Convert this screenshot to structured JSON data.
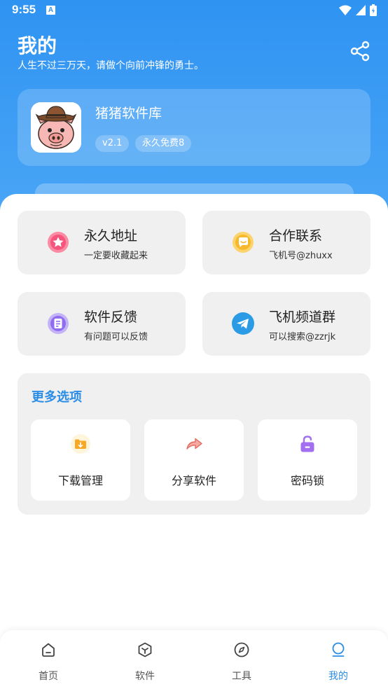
{
  "status_bar": {
    "time": "9:55",
    "notification_icon": "A"
  },
  "header": {
    "title": "我的",
    "subtitle": "人生不过三万天，请做个向前冲锋的勇士。",
    "share_icon": "share-icon"
  },
  "app_card": {
    "name": "猪猪软件库",
    "version": "v2.1",
    "badge": "永久免费8",
    "logo": "pig-cowboy-logo"
  },
  "tiles": [
    {
      "title": "永久地址",
      "subtitle": "一定要收藏起来",
      "icon": "star-icon",
      "color": "#f5547d"
    },
    {
      "title": "合作联系",
      "subtitle": "飞机号@zhuxx",
      "icon": "chat-bubble-icon",
      "color": "#f7b92b"
    },
    {
      "title": "软件反馈",
      "subtitle": "有问题可以反馈",
      "icon": "feedback-icon",
      "color": "#8f6cf0"
    },
    {
      "title": "飞机频道群",
      "subtitle": "可以搜索@zzrjk",
      "icon": "telegram-icon",
      "color": "#2b9be6"
    }
  ],
  "more": {
    "title": "更多选项",
    "options": [
      {
        "label": "下载管理",
        "icon": "download-folder-icon"
      },
      {
        "label": "分享软件",
        "icon": "share-arrow-icon"
      },
      {
        "label": "密码锁",
        "icon": "lock-icon"
      }
    ]
  },
  "tabbar": [
    {
      "label": "首页",
      "icon": "home-icon",
      "active": false
    },
    {
      "label": "软件",
      "icon": "box-icon",
      "active": false
    },
    {
      "label": "工具",
      "icon": "compass-icon",
      "active": false
    },
    {
      "label": "我的",
      "icon": "profile-icon",
      "active": true
    }
  ],
  "colors": {
    "primary": "#2f93f2",
    "accent_text": "#2b8de6",
    "tile_bg": "#f0f0f0"
  }
}
